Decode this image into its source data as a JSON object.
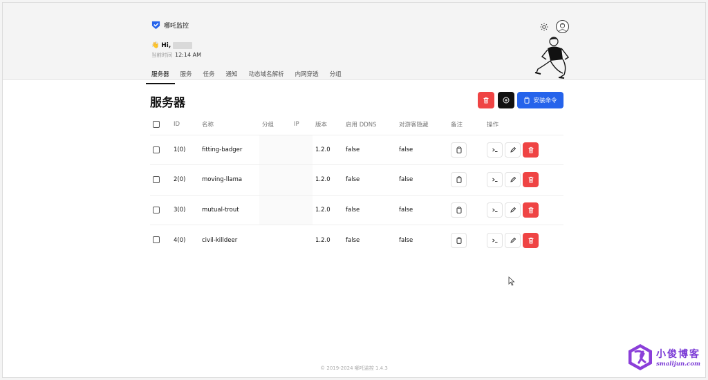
{
  "app": {
    "title": "哪吒监控"
  },
  "greeting": {
    "hi": "Hi,",
    "time_label": "当前时间",
    "time": "12:14 AM"
  },
  "tabs": [
    {
      "label": "服务器"
    },
    {
      "label": "服务"
    },
    {
      "label": "任务"
    },
    {
      "label": "通知"
    },
    {
      "label": "动态域名解析"
    },
    {
      "label": "内网穿透"
    },
    {
      "label": "分组"
    }
  ],
  "page": {
    "title": "服务器",
    "install_label": "安装命令"
  },
  "table": {
    "headers": [
      "ID",
      "名称",
      "分组",
      "IP",
      "版本",
      "启用 DDNS",
      "对游客隐藏",
      "备注",
      "操作"
    ],
    "rows": [
      {
        "id": "1(0)",
        "name": "fitting-badger",
        "version": "1.2.0",
        "ddns": "false",
        "hidden": "false"
      },
      {
        "id": "2(0)",
        "name": "moving-llama",
        "version": "1.2.0",
        "ddns": "false",
        "hidden": "false"
      },
      {
        "id": "3(0)",
        "name": "mutual-trout",
        "version": "1.2.0",
        "ddns": "false",
        "hidden": "false"
      },
      {
        "id": "4(0)",
        "name": "civil-killdeer",
        "version": "1.2.0",
        "ddns": "false",
        "hidden": "false"
      }
    ]
  },
  "footer": {
    "text": "© 2019-2024 哪吒监控 1.4.3"
  },
  "watermark": {
    "title": "小俊博客",
    "url": "smalljun.com"
  },
  "colors": {
    "danger": "#ef4444",
    "primary": "#2563eb",
    "dark": "#111111",
    "watermark": "#7b3bd6"
  },
  "icons": [
    "shield-logo-icon",
    "sun-icon",
    "avatar",
    "trash-icon",
    "plus-circle-icon",
    "clipboard-icon",
    "terminal-icon",
    "pencil-icon",
    "cursor-icon"
  ]
}
